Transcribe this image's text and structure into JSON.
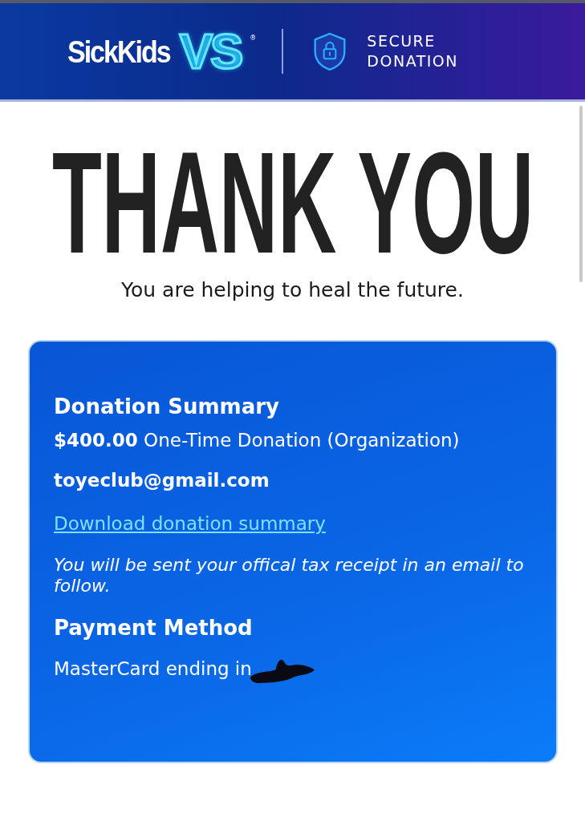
{
  "header": {
    "brand": "SickKids",
    "logo_mark": "VS",
    "registered": "®",
    "secure_label": [
      "SECURE",
      "DONATION"
    ]
  },
  "title": "THANK YOU",
  "subtitle": "You are helping to heal the future.",
  "summary": {
    "heading": "Donation Summary",
    "amount": "**$400.00** One-Time Donation (Organization)",
    "email": "toyeclub@gmail.com",
    "download_link": "Download donation summary",
    "note": "You will be sent your offical tax receipt in an email to follow.",
    "payment_heading": "Payment Method",
    "payment_text": "MasterCard ending in"
  }
}
